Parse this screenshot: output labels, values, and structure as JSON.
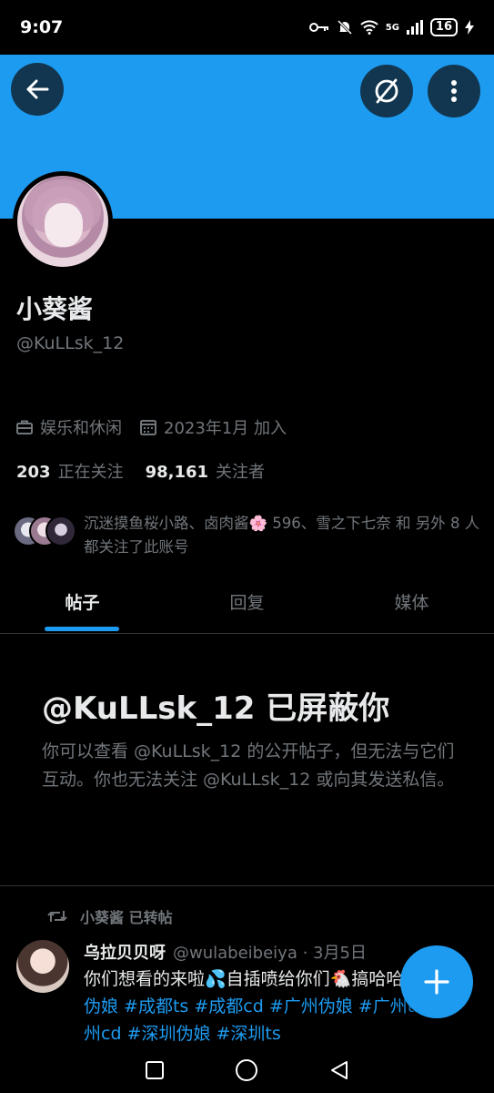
{
  "status_bar": {
    "time": "9:07",
    "network": "5G",
    "battery": "16"
  },
  "profile": {
    "display_name": "小葵酱",
    "handle": "@KuLLsk_12",
    "category": "娱乐和休闲",
    "joined": "2023年1月 加入",
    "following_count": "203",
    "following_label": "正在关注",
    "followers_count": "98,161",
    "followers_label": "关注者",
    "known_followers": "沉迷摸鱼桜小路、卤肉酱🌸 596、雪之下七奈 和 另外 8 人 都关注了此账号"
  },
  "tabs": [
    {
      "label": "帖子",
      "active": true
    },
    {
      "label": "回复",
      "active": false
    },
    {
      "label": "媒体",
      "active": false
    }
  ],
  "blocked": {
    "title": "@KuLLsk_12 已屏蔽你",
    "description": "你可以查看 @KuLLsk_12 的公开帖子，但无法与它们互动。你也无法关注 @KuLLsk_12 或向其发送私信。"
  },
  "post": {
    "repost_label": "小葵酱 已转帖",
    "author": "乌拉贝贝呀",
    "author_handle": "@wulabeibeiya · 3月5日",
    "text": "你们想看的来啦💦自插喷给你们🐔搞哈哈",
    "hashtags": "#成都伪娘 #成都ts #成都cd #广州伪娘 #广州ts #广州cd #深圳伪娘 #深圳ts"
  },
  "colors": {
    "accent": "#1d9bf0",
    "background": "#000000",
    "secondary_text": "#71767b"
  }
}
